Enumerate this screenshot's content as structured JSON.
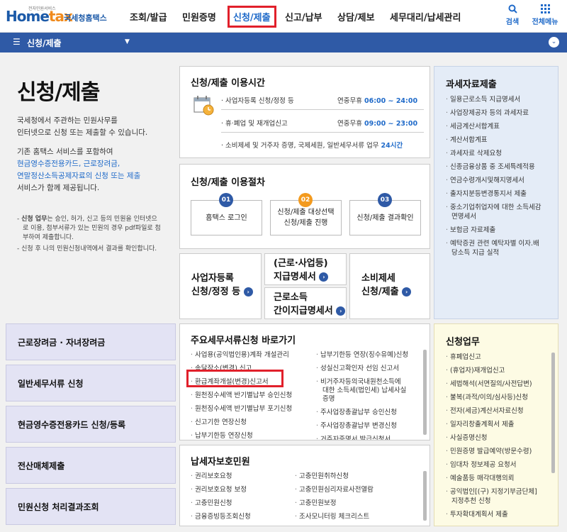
{
  "logo": {
    "small": "전자민원서비스",
    "main_a": "Home",
    "main_b": "tax",
    "kr": "국세청홈택스"
  },
  "nav": {
    "items": [
      "조회/발급",
      "민원증명",
      "신청/제출",
      "신고/납부",
      "상담/제보",
      "세무대리/납세관리"
    ],
    "active": "신청/제출",
    "search": "검색",
    "menu": "전체메뉴"
  },
  "section_bar": {
    "label": "신청/제출"
  },
  "intro": {
    "title": "신청/제출",
    "p1a": "국세청에서 주관하는 민원사무를",
    "p1b": "인터넷으로 신청 또는 제출할 수 있습니다.",
    "p2a": "기존 홈택스 서비스를 포함하여",
    "p2b": "현금영수증전용카드, 근로장려금,",
    "p2c": "연말정산소득공제자료의 신청 또는 제출",
    "p2d": "서비스가 함께 제공됩니다.",
    "note1_strong": "신청 업무",
    "note1a": "는 승인, 허가, 신고 등의 민원을 인터넷으",
    "note1b": "로 이용, 첨부서류가 있는 민원의 경우 pdf파일로 첨",
    "note1c": "부하여 제출합니다.",
    "note2": "신청 후 나의 민원신청내역에서 결과를 확인합니다."
  },
  "hours": {
    "title": "신청/제출 이용시간",
    "rows": [
      {
        "label": "· 사업자등록 신청/정정 등",
        "days": "연중무휴",
        "time": "06:00 ~ 24:00"
      },
      {
        "label": "· 휴·폐업 및 재개업신고",
        "days": "연중무휴",
        "time": "09:00 ~ 23:00"
      },
      {
        "label": "· 소비제세 및 거주자 증명, 국제세원, 일반세무서류 업무",
        "days": "",
        "time": "24시간"
      }
    ]
  },
  "procedure": {
    "title": "신청/제출 이용절차",
    "steps": [
      {
        "num": "01",
        "line1": "홈택스 로그인",
        "line2": ""
      },
      {
        "num": "02",
        "line1": "신청/제출 대상선택",
        "line2": "신청/제출 진행"
      },
      {
        "num": "03",
        "line1": "신청/제출 결과확인",
        "line2": ""
      }
    ]
  },
  "quick_buttons": {
    "b1a": "사업자등록",
    "b1b": "신청/정정 등",
    "b2a": "(근로·사업등)",
    "b2b": "지급명세서",
    "b3a": "근로소득",
    "b3b": "간이지급명세서",
    "b4a": "소비제세",
    "b4b": "신청/제출"
  },
  "left_buttons": [
    "근로장려금 · 자녀장려금",
    "일반세무서류 신청",
    "현금영수증전용카드 신청/등록",
    "전산매체제출",
    "민원신청 처리결과조회"
  ],
  "shortcuts": {
    "title": "주요세무서류신청 바로가기",
    "col1": [
      "사업용(공익법인용)계좌 개설관리",
      "송달장소(변경) 신고",
      "환급계좌개설(변경)신고서",
      "원천징수세액 반기별납부 승인신청",
      "원천징수세액 반기별납부 포기신청",
      "신고기한 연장신청",
      "납부기한등 연장신청"
    ],
    "col2": [
      "납부기한등 연장(징수유예)신청",
      "성실신고확인자 선임 신고서",
      "비거주자등의국내원천소득에",
      "대한 소득세(법인세) 납세사실",
      "증명",
      "주사업장총괄납부 승인신청",
      "주사업장총괄납부 변경신청",
      "거주자증명서 발급신청서"
    ]
  },
  "protection": {
    "title": "납세자보호민원",
    "col1": [
      "권리보호요청",
      "권리보호요청 보정",
      "고충민원신청",
      "금융증빙등조회신청"
    ],
    "col2": [
      "고충민원취하신청",
      "고충민원심리자료사전열람",
      "고충민원보정",
      "조사모니터링 체크리스트"
    ]
  },
  "tax_data": {
    "title": "과세자료제출",
    "items": [
      "일용근로소득 지급명세서",
      "사업장제공자 등의 과세자료",
      "세금계산서합계표",
      "계산서합계표",
      "과세자료 삭제요청",
      "신종금융상품 중 조세특례적용",
      "연금수령개시및해지명세서",
      "출자지분등변경통지서 제출",
      "중소기업취업자에 대한 소득세감",
      "면명세서",
      "보험금 자료제출",
      "예탁증권 관련 예탁자별 이자.배",
      "당소득 지급 실적"
    ]
  },
  "apply_tasks": {
    "title": "신청업무",
    "items": [
      "휴폐업신고",
      "(휴업자)재개업신고",
      "세법해석(서면질의/사전답변)",
      "불복(과적/이의/심사등)신청",
      "전자(세금)계산서자료신청",
      "일자리창출계획서 제출",
      "사실증명신청",
      "민원증명 발급예약(방문수령)",
      "임대차 정보제공 요청서",
      "예술품등 매각대행의뢰",
      "공익법인[(구) 지정기부금단체]",
      "지정추천 신청",
      "투자확대계획서 제출"
    ]
  },
  "colors": {
    "brand": "#2f5aa6",
    "highlight": "#e1202b",
    "step1": "#2f5aa6",
    "step2": "#f39a1e",
    "step3": "#2f5aa6"
  }
}
